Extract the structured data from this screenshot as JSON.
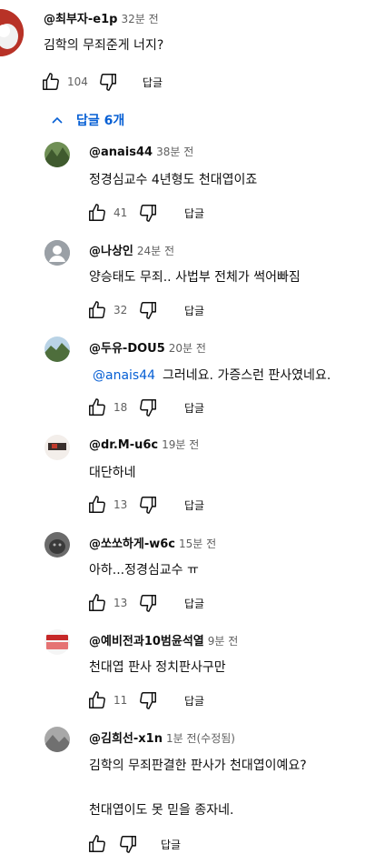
{
  "parent": {
    "handle": "@최부자-e1p",
    "time": "32분 전",
    "text": "김학의 무죄준게 너지?",
    "likes": "104",
    "reply_label": "답글",
    "avatar_color": "#c0392b"
  },
  "replies_toggle": {
    "label": "답글 6개",
    "icon": "chevron-up-icon"
  },
  "replies": [
    {
      "handle": "@anais44",
      "time": "38분 전",
      "text": "정경심교수 4년형도 천대엽이죠",
      "likes": "41",
      "reply_label": "답글",
      "avatar_color": "#4f6b3a"
    },
    {
      "handle": "@나상인",
      "time": "24분 전",
      "text": "양승태도 무죄.. 사법부 전체가 썩어빠짐",
      "likes": "32",
      "reply_label": "답글",
      "avatar_color": "#9aa0a6"
    },
    {
      "handle": "@두유-DOU5",
      "time": "20분 전",
      "mention": "@anais44",
      "text": "그러네요. 가증스런 판사였네요.",
      "likes": "18",
      "reply_label": "답글",
      "avatar_color": "#5b7d4a"
    },
    {
      "handle": "@dr.M-u6c",
      "time": "19분 전",
      "text": "대단하네",
      "likes": "13",
      "reply_label": "답글",
      "avatar_color": "#e8e0dc"
    },
    {
      "handle": "@쏘쏘하게-w6c",
      "time": "15분 전",
      "text": "아하...정경심교수 ㅠ",
      "likes": "13",
      "reply_label": "답글",
      "avatar_color": "#4a4a4a"
    },
    {
      "handle": "@예비전과10범윤석열",
      "time": "9분 전",
      "text": "천대엽 판사 정치판사구만",
      "likes": "11",
      "reply_label": "답글",
      "avatar_color": "#c62828"
    },
    {
      "handle": "@김희선-x1n",
      "time": "1분 전(수정됨)",
      "text_lines": [
        "김학의 무죄판결한 판사가 천대엽이예요?",
        "천대엽이도 못 믿을 종자네."
      ],
      "likes": "",
      "reply_label": "답글",
      "avatar_color": "#8d8d8d"
    }
  ]
}
